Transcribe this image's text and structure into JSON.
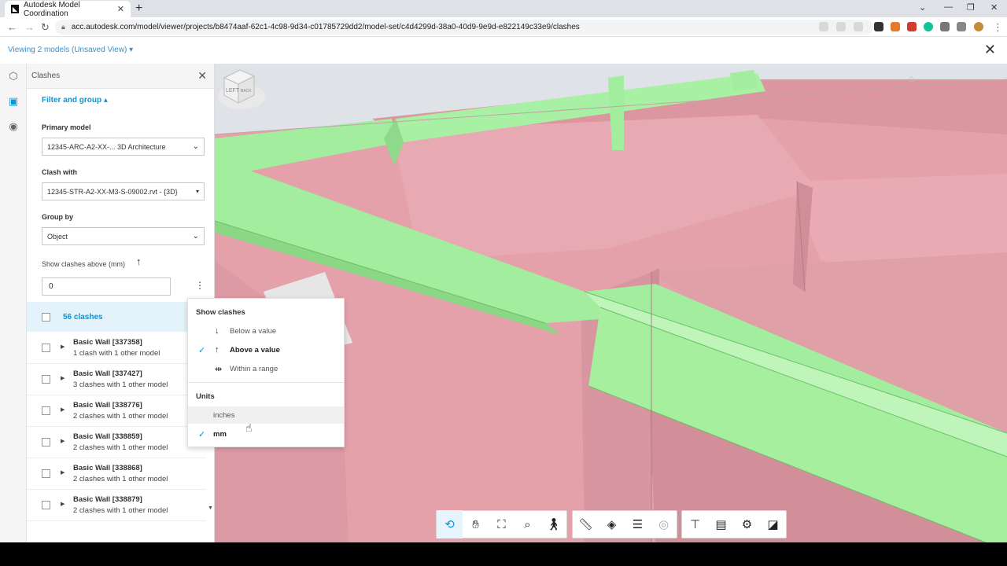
{
  "browser": {
    "tab_title": "Autodesk Model Coordination",
    "tab_close": "✕",
    "new_tab": "+",
    "url": "acc.autodesk.com/model/viewer/projects/b8474aaf-62c1-4c98-9d34-c01785729dd2/model-set/c4d4299d-38a0-40d9-9e9d-e822149c33e9/clashes"
  },
  "app": {
    "viewing_label": "Viewing 2 models (Unsaved View)",
    "viewing_caret": "▾",
    "close_glyph": "✕"
  },
  "panel": {
    "title": "Clashes",
    "close_glyph": "✕",
    "filter_toggle": "Filter and group ▴",
    "primary_model_label": "Primary model",
    "primary_model_value": "12345-ARC-A2-XX-... 3D Architecture",
    "clash_with_label": "Clash with",
    "clash_with_value": "12345-STR-A2-XX-M3-S-09002.rvt - {3D}",
    "group_by_label": "Group by",
    "group_by_value": "Object",
    "threshold_label": "Show clashes above (mm)",
    "threshold_value": "0",
    "summary": "56 clashes",
    "rows": [
      {
        "name": "Basic Wall [337358]",
        "detail": "1 clash with 1 other model"
      },
      {
        "name": "Basic Wall [337427]",
        "detail": "3 clashes with 1 other model"
      },
      {
        "name": "Basic Wall [338776]",
        "detail": "2 clashes with 1 other model"
      },
      {
        "name": "Basic Wall [338859]",
        "detail": "2 clashes with 1 other model"
      },
      {
        "name": "Basic Wall [338868]",
        "detail": "2 clashes with 1 other model"
      },
      {
        "name": "Basic Wall [338879]",
        "detail": "2 clashes with 1 other model"
      }
    ]
  },
  "menu": {
    "show_header": "Show clashes",
    "below": "Below a value",
    "above": "Above a value",
    "range": "Within a range",
    "units_header": "Units",
    "inches": "inches",
    "mm": "mm"
  },
  "viewcube": {
    "face": "LEFT",
    "side": "BACK"
  },
  "colors": {
    "accent": "#0696d7",
    "architecture": "#e9a3ab",
    "structure": "#a3efa0"
  },
  "icons": {
    "orbit": "orbit-icon",
    "pan": "pan-icon",
    "fit": "fit-to-view-icon",
    "zoom": "zoom-icon",
    "walk": "first-person-icon",
    "measure": "measure-icon",
    "section": "section-icon",
    "layers": "layers-icon",
    "ghost": "ghosting-icon",
    "tree": "model-browser-icon",
    "properties": "properties-icon",
    "settings": "settings-icon",
    "fullscreen": "fullscreen-icon"
  }
}
